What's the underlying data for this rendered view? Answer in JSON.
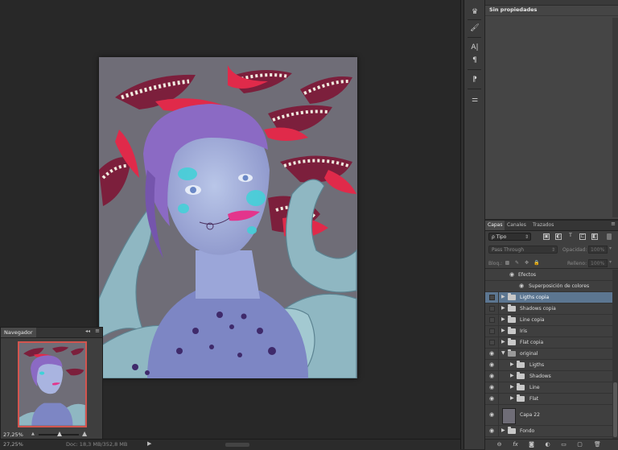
{
  "navigator": {
    "tab_label": "Navegador",
    "collapse_glyph": "◂◂",
    "menu_glyph": "≡",
    "zoom_value": "27,25%",
    "zoom_out_glyph": "▲",
    "zoom_in_glyph": "▲"
  },
  "status": {
    "zoom": "27,25%",
    "doc": "Doc: 18,3 MB/352,8 MB",
    "arrow": "▶"
  },
  "properties": {
    "title": "Sin propiedades"
  },
  "toolstrip": {
    "icons": [
      "history-icon",
      "brush-preset-icon",
      "character-icon",
      "paragraph-icon",
      "clone-source-icon",
      "adjust-icon"
    ],
    "glyphs": [
      "♛",
      "🖌",
      "A|",
      "¶",
      "⁋",
      "⚌"
    ]
  },
  "layers": {
    "tabs": [
      "Capas",
      "Canales",
      "Trazados"
    ],
    "active_tab": "Capas",
    "menu_glyph": "≡",
    "filter_label": "ρ Tipo",
    "filter_icons": [
      "▣",
      "◐",
      "T",
      "⊏",
      "◧"
    ],
    "blend_mode": "Pass Through",
    "opacity_label": "Opacidad:",
    "opacity_value": "100%",
    "lock_label": "Bloq.:",
    "lock_icons": [
      "▩",
      "✎",
      "✥",
      "🔒"
    ],
    "fill_label": "Relleno:",
    "fill_value": "100%",
    "rows": [
      {
        "name": "Efectos",
        "kind": "effects"
      },
      {
        "name": "Superposición de colores",
        "kind": "effect"
      },
      {
        "name": "Ligths copia",
        "kind": "group",
        "selected": true,
        "visible": false
      },
      {
        "name": "Shadows copia",
        "kind": "group",
        "visible": false
      },
      {
        "name": "Line copia",
        "kind": "group",
        "visible": false
      },
      {
        "name": "Iris",
        "kind": "group",
        "visible": false
      },
      {
        "name": "Flat copia",
        "kind": "group",
        "visible": false
      },
      {
        "name": "original",
        "kind": "group-open",
        "visible": true
      },
      {
        "name": "Ligths",
        "kind": "subgroup",
        "visible": true
      },
      {
        "name": "Shadows",
        "kind": "subgroup",
        "visible": true
      },
      {
        "name": "Line",
        "kind": "subgroup",
        "visible": true
      },
      {
        "name": "Flat",
        "kind": "subgroup",
        "visible": true
      },
      {
        "name": "Capa 22",
        "kind": "layer",
        "visible": true
      },
      {
        "name": "Fondo",
        "kind": "group",
        "visible": true
      }
    ],
    "bottom_icons": [
      "link-icon",
      "fx-icon",
      "mask-icon",
      "adjustment-icon",
      "new-group-icon",
      "new-layer-icon",
      "trash-icon"
    ],
    "bottom_glyphs": [
      "⊖",
      "fx",
      "◙",
      "◐",
      "▭",
      "▢",
      "🗑"
    ]
  },
  "colors": {
    "artwork_bg": "#6f6d77",
    "selection_blue": "#5c7691",
    "navigator_frame": "#d3554f"
  }
}
